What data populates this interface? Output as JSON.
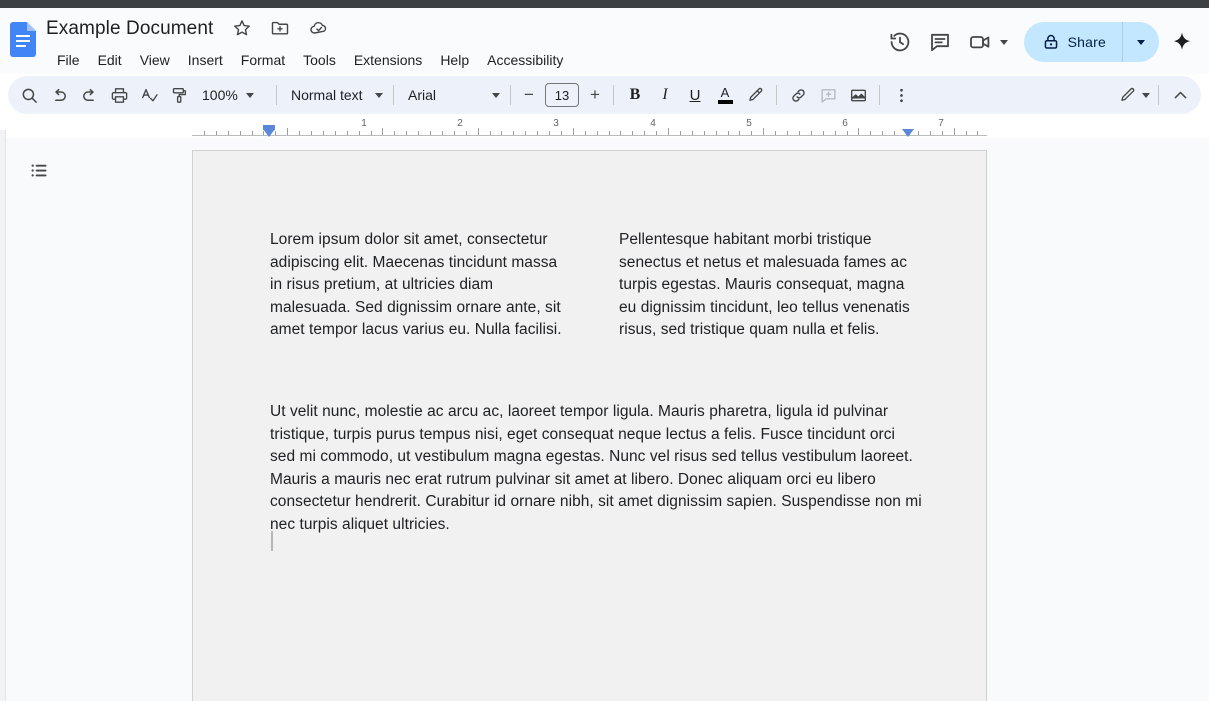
{
  "document": {
    "title": "Example Document",
    "title_icons": [
      "star-icon",
      "move-to-folder-icon",
      "cloud-saved-icon"
    ]
  },
  "menu": {
    "items": [
      {
        "label": "File"
      },
      {
        "label": "Edit"
      },
      {
        "label": "View"
      },
      {
        "label": "Insert"
      },
      {
        "label": "Format"
      },
      {
        "label": "Tools"
      },
      {
        "label": "Extensions"
      },
      {
        "label": "Help"
      },
      {
        "label": "Accessibility"
      }
    ]
  },
  "header_right": {
    "version_history_icon": "history-icon",
    "comments_icon": "comment-icon",
    "meet_icon": "video-call-icon",
    "share": {
      "label": "Share",
      "lock_icon": "lock-icon",
      "caret_icon": "chevron-down-icon",
      "background": "#c2e7ff",
      "text_color": "#041e49"
    },
    "gemini_icon": "gemini-sparkle-icon"
  },
  "toolbar": {
    "search_icon": "search-icon",
    "undo_icon": "undo-icon",
    "redo_icon": "redo-icon",
    "print_icon": "print-icon",
    "spellcheck_icon": "spellcheck-icon",
    "paint_format_icon": "paint-format-icon",
    "zoom_level": "100%",
    "paragraph_style": "Normal text",
    "font_family": "Arial",
    "font_size": "13",
    "decrease_font_label": "−",
    "increase_font_label": "+",
    "bold_label": "B",
    "italic_label": "I",
    "underline_label": "U",
    "text_color_label": "A",
    "highlight_icon": "highlight-pen-icon",
    "link_icon": "insert-link-icon",
    "comment_icon": "add-comment-icon",
    "image_icon": "insert-image-icon",
    "more_icon": "more-options-icon",
    "editing_mode_icon": "edit-pencil-icon",
    "collapse_icon": "chevron-up-icon",
    "background": "#edf2fa"
  },
  "ruler": {
    "numbers": [
      "1",
      "2",
      "3",
      "4",
      "5",
      "6",
      "7"
    ],
    "left_indent_marker": "left-indent-marker",
    "right_indent_marker": "right-indent-marker",
    "marker_color": "#5b87d8"
  },
  "sidebar": {
    "outline_icon": "document-outline-icon"
  },
  "page": {
    "background": "#f1f1f1",
    "columns": [
      {
        "text": "Lorem ipsum dolor sit amet, consectetur adipiscing elit. Maecenas tincidunt massa in risus pretium, at ultricies diam malesuada. Sed dignissim ornare ante, sit amet tempor lacus varius eu. Nulla facilisi."
      },
      {
        "text": "Pellentesque habitant morbi tristique senectus et netus et malesuada fames ac turpis egestas. Mauris consequat, magna eu dignissim tincidunt, leo tellus venenatis risus, sed tristique quam nulla et felis."
      }
    ],
    "body_paragraph": "Ut velit nunc, molestie ac arcu ac, laoreet tempor ligula. Mauris pharetra, ligula id pulvinar tristique, turpis purus tempus nisi, eget consequat neque lectus a felis. Fusce tincidunt orci sed mi commodo, ut vestibulum magna egestas. Nunc vel risus sed tellus vestibulum laoreet. Mauris a mauris nec erat rutrum pulvinar sit amet at libero. Donec aliquam orci eu libero consectetur hendrerit. Curabitur id ornare nibh, sit amet dignissim sapien. Suspendisse non mi nec turpis aliquet ultricies."
  }
}
